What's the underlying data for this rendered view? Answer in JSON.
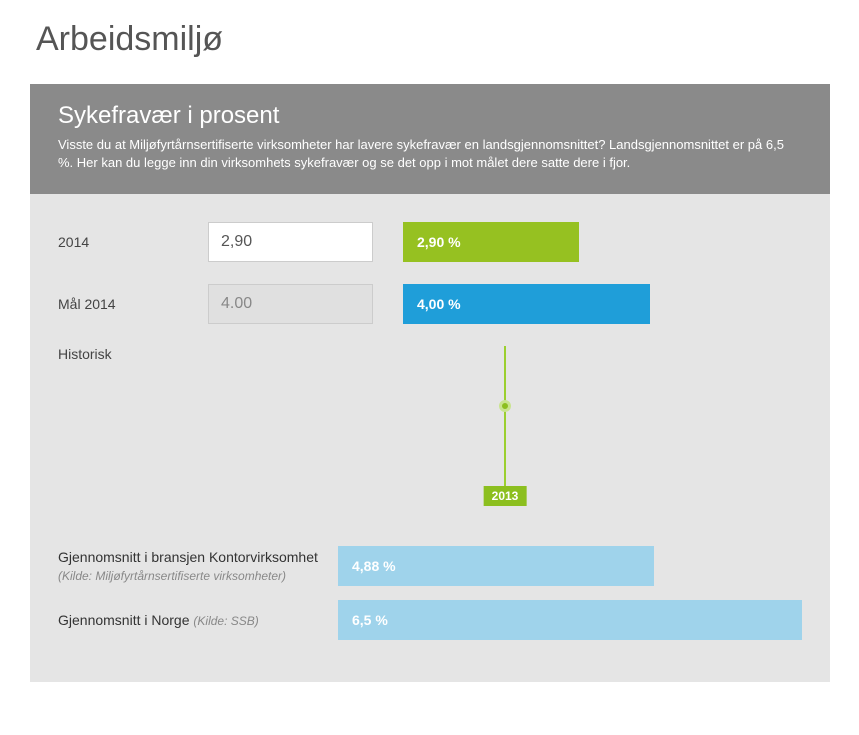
{
  "page": {
    "title": "Arbeidsmiljø"
  },
  "card": {
    "title": "Sykefravær i prosent",
    "desc": "Visste du at Miljøfyrtårnsertifiserte virksomheter har lavere sykefravær en landsgjennomsnittet? Landsgjennomsnittet er på 6,5 %. Her kan du legge inn din virksomhets sykefravær og se det opp i mot målet dere satte dere i fjor."
  },
  "rows": {
    "current": {
      "label": "2014",
      "input": "2,90",
      "bar_text": "2,90 %",
      "bar_pct": 44
    },
    "goal": {
      "label": "Mål 2014",
      "input": "4.00",
      "bar_text": "4,00 %",
      "bar_pct": 62
    }
  },
  "historic": {
    "label": "Historisk",
    "badge": "2013"
  },
  "averages": {
    "industry": {
      "label_main": "Gjennomsnitt i bransjen Kontorvirksomhet ",
      "label_src": "(Kilde: Miljøfyrtårnsertifiserte virksomheter)",
      "bar_text": "4,88 %",
      "bar_pct": 68
    },
    "national": {
      "label_main": "Gjennomsnitt i Norge ",
      "label_src": "(Kilde: SSB)",
      "bar_text": "6,5 %",
      "bar_pct": 100
    }
  },
  "chart_data": {
    "type": "bar",
    "title": "Sykefravær i prosent",
    "xlabel": "",
    "ylabel": "%",
    "ylim": [
      0,
      6.5
    ],
    "series": [
      {
        "name": "2014",
        "value": 2.9,
        "color": "#96c121"
      },
      {
        "name": "Mål 2014",
        "value": 4.0,
        "color": "#1f9ed9"
      },
      {
        "name": "Gjennomsnitt i bransjen Kontorvirksomhet",
        "value": 4.88,
        "color": "#9fd3eb",
        "source": "Miljøfyrtårnsertifiserte virksomheter"
      },
      {
        "name": "Gjennomsnitt i Norge",
        "value": 6.5,
        "color": "#9fd3eb",
        "source": "SSB"
      }
    ],
    "historic": [
      {
        "year": 2013
      }
    ]
  }
}
